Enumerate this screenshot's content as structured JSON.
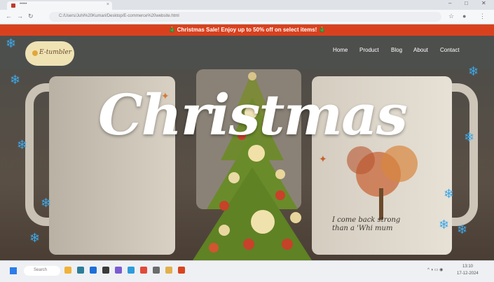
{
  "browser": {
    "tab_title": "•••••",
    "url": "C:/Users/Juhi%20Kumari/Desktop/E-commerce%20website.html",
    "window_controls": [
      "–",
      "□",
      "✕"
    ]
  },
  "promo": {
    "text": "🎄 Christmas Sale! Enjoy up to 50% off on select items! 🎄"
  },
  "site": {
    "logo_text": "E-tumbler",
    "menu": [
      "Home",
      "Product",
      "Blog",
      "About",
      "Contact"
    ]
  },
  "hero": {
    "title": "Christmas",
    "mug_quote": "I come back strong than a 'Whi mum"
  },
  "taskbar": {
    "search_label": "Search",
    "tray_time": "13:10",
    "tray_date": "17-12-2024"
  },
  "colors": {
    "promo_bg": "#d9411e",
    "nav_bg": "#4d4f4d",
    "logo_bg": "#efe3b4",
    "snowflake": "#3fa7e6"
  }
}
